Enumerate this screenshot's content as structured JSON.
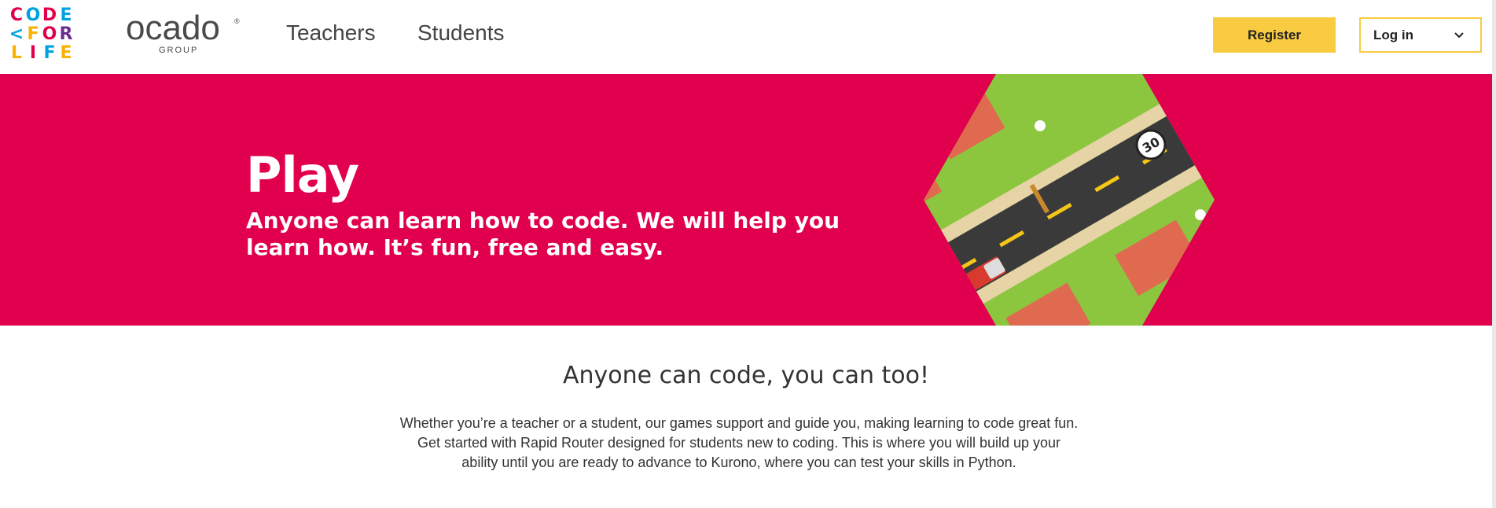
{
  "header": {
    "logo": {
      "rows": [
        [
          {
            "ch": "C",
            "color": "#e0004d"
          },
          {
            "ch": "O",
            "color": "#00a3e0"
          },
          {
            "ch": "D",
            "color": "#e0004d"
          },
          {
            "ch": "E",
            "color": "#00a3e0"
          }
        ],
        [
          {
            "ch": "<",
            "color": "#00a3e0"
          },
          {
            "ch": "F",
            "color": "#f9b200"
          },
          {
            "ch": "O",
            "color": "#e0004d"
          },
          {
            "ch": "R",
            "color": "#6e2d91"
          }
        ],
        [
          {
            "ch": "L",
            "color": "#f9b200"
          },
          {
            "ch": "I",
            "color": "#e0004d"
          },
          {
            "ch": "F",
            "color": "#00a3e0"
          },
          {
            "ch": "E",
            "color": "#f9b200"
          }
        ]
      ]
    },
    "ocado": {
      "word": "ocado",
      "reg": "®",
      "group": "GROUP"
    },
    "nav": [
      {
        "label": "Teachers"
      },
      {
        "label": "Students"
      }
    ],
    "register_label": "Register",
    "login_label": "Log in"
  },
  "hero": {
    "title": "Play",
    "subtitle": "Anyone can learn how to code. We will help you learn how. It’s fun, free and easy.",
    "speed_sign": "30",
    "colors": {
      "background": "#e0004d",
      "grass": "#8cc63f",
      "road": "#3a3a3a",
      "roof": "#e06a50",
      "van": "#d93a2f"
    }
  },
  "intro": {
    "title": "Anyone can code, you can too!",
    "lines": [
      "Whether you’re a teacher or a student, our games support and guide you, making learning to code great fun.",
      "Get started with Rapid Router designed for students new to coding. This is where you will build up your",
      "ability until you are ready to advance to Kurono, where you can test your skills in Python."
    ]
  },
  "colors": {
    "accent_yellow": "#f9cb40",
    "hero_pink": "#e0004d"
  }
}
